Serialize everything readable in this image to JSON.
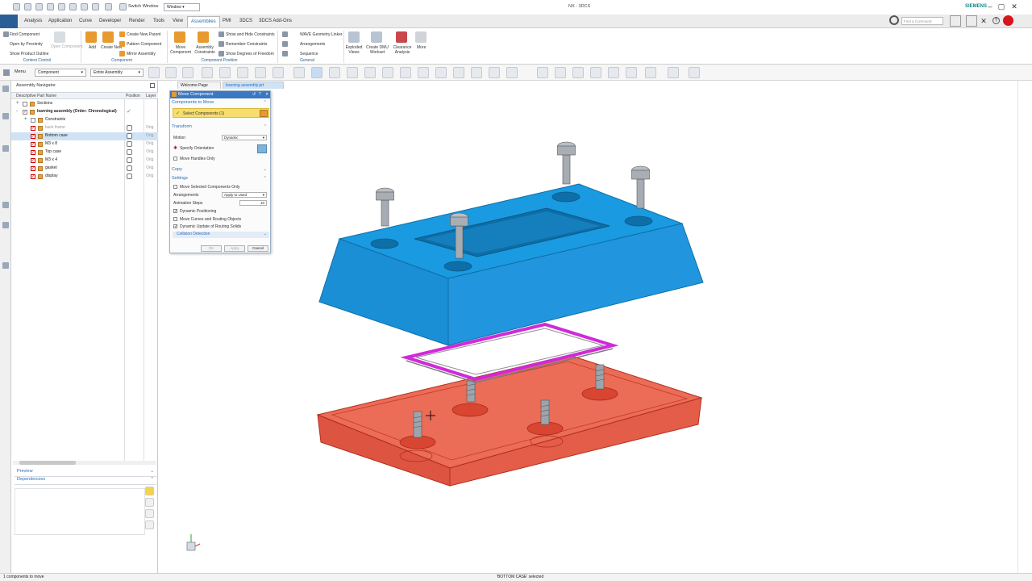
{
  "window": {
    "title": "NX - 3DCS",
    "brand": "SIEMENS",
    "switch_window": "Switch Window",
    "window_menu": "Window",
    "search_placeholder": "Find a Command"
  },
  "ribbon_tabs": [
    "Analysis",
    "Application",
    "Curve",
    "Developer",
    "Render",
    "Tools",
    "View",
    "Assemblies",
    "PMI",
    "3DCS",
    "3DCS Add-Ons"
  ],
  "active_tab": "Assemblies",
  "ribbon": {
    "context_control": {
      "items": [
        "Find Component",
        "Open by Proximity",
        "Show Product Outline"
      ],
      "group": "Context Control"
    },
    "component": {
      "big": [
        "Add",
        "Create New"
      ],
      "open_component": "Open Component",
      "items": [
        "Create New Parent",
        "Pattern Component",
        "Mirror Assembly"
      ],
      "group": "Component"
    },
    "component_position": {
      "big": [
        "Move Component",
        "Assembly Constraints"
      ],
      "items": [
        "Show and Hide Constraints",
        "Remember Constraints",
        "Show Degrees of Freedom"
      ],
      "group": "Component Position"
    },
    "general": {
      "items": [
        "WAVE Geometry Linker",
        "Arrangements",
        "Sequence"
      ],
      "group": "General"
    },
    "right_big": [
      "Exploded Views",
      "Create DMU Workset",
      "Clearance Analysis",
      "More"
    ]
  },
  "selbar": {
    "menu": "Menu",
    "filter": "Component",
    "scope": "Entire Assembly"
  },
  "navigator": {
    "title": "Assembly Navigator",
    "columns": [
      "Descriptive Part Name",
      "Position",
      "Layer"
    ],
    "rows": [
      {
        "name": "Sections",
        "expand": "+",
        "level": 0,
        "check": "",
        "grey": false,
        "bold": false,
        "layer": ""
      },
      {
        "name": "learning assembly (Order: Chronological)",
        "expand": "-",
        "level": 0,
        "check": "✓",
        "grey": false,
        "bold": true,
        "layer": ""
      },
      {
        "name": "Constraints",
        "expand": "+",
        "level": 1,
        "check": "",
        "grey": false,
        "bold": false,
        "layer": ""
      },
      {
        "name": "back frame",
        "expand": "",
        "level": 1,
        "check": "✓",
        "grey": true,
        "bold": false,
        "layer": "Orig"
      },
      {
        "name": "Bottom case",
        "expand": "",
        "level": 1,
        "check": "✓",
        "grey": false,
        "bold": false,
        "layer": "Orig"
      },
      {
        "name": "M3 x 8",
        "expand": "",
        "level": 1,
        "check": "✓",
        "grey": false,
        "bold": false,
        "layer": "Orig"
      },
      {
        "name": "Top case",
        "expand": "",
        "level": 1,
        "check": "✓",
        "grey": false,
        "bold": false,
        "layer": "Orig"
      },
      {
        "name": "M3 x 4",
        "expand": "",
        "level": 1,
        "check": "✓",
        "grey": false,
        "bold": false,
        "layer": "Orig"
      },
      {
        "name": "gasket",
        "expand": "",
        "level": 1,
        "check": "✓",
        "grey": false,
        "bold": false,
        "layer": "Orig"
      },
      {
        "name": "display",
        "expand": "",
        "level": 1,
        "check": "✓",
        "grey": false,
        "bold": false,
        "layer": "Orig"
      }
    ],
    "selected_index": 4,
    "preview": "Preview",
    "dependencies": "Dependencies"
  },
  "graphics_tabs": [
    "Welcome Page",
    "learning assembly.prt"
  ],
  "dialog": {
    "title": "Move Component",
    "components_to_move": "Components to Move",
    "select_components": "Select Components (1)",
    "transform": "Transform",
    "motion_label": "Motion",
    "motion_value": "Dynamic",
    "specify_orientation": "Specify Orientation",
    "move_handles_only": "Move Handles Only",
    "copy": "Copy",
    "settings": "Settings",
    "move_selected_only": "Move Selected Components Only",
    "arrangements_label": "Arrangements",
    "arrangements_value": "Apply to Used",
    "animation_steps_label": "Animation Steps",
    "animation_steps_value": "10",
    "dynamic_positioning": "Dynamic Positioning",
    "move_curves": "Move Curves and Routing Objects",
    "dynamic_update": "Dynamic Update of Routing Solids",
    "collision_detection": "Collision Detection",
    "ok": "OK",
    "apply": "Apply",
    "cancel": "Cancel",
    "checks": {
      "move_handles_only": false,
      "move_selected_only": false,
      "dynamic_positioning": true,
      "move_curves": false,
      "dynamic_update": true
    }
  },
  "status": {
    "left": "1 components to move",
    "center": "'BOTTOM CASE' selected"
  },
  "colors": {
    "accent": "#3a78c2",
    "top_case": "#1a9ae0",
    "bottom_case": "#e8523a",
    "gasket": "#d02ad8"
  }
}
